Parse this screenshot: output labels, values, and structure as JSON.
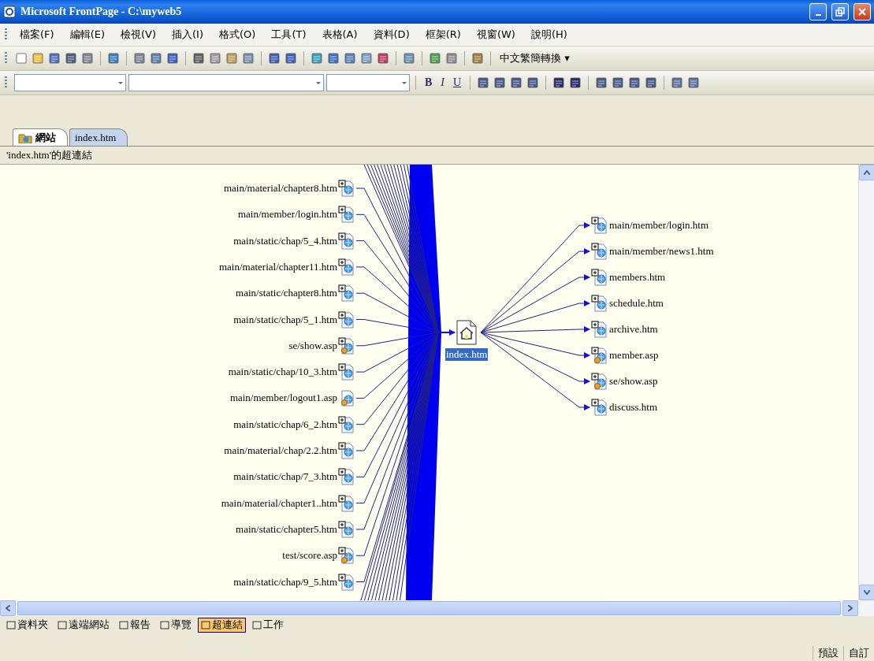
{
  "window": {
    "title": "Microsoft FrontPage - C:\\myweb5"
  },
  "menu": [
    "檔案(F)",
    "編輯(E)",
    "檢視(V)",
    "插入(I)",
    "格式(O)",
    "工具(T)",
    "表格(A)",
    "資料(D)",
    "框架(R)",
    "視窗(W)",
    "說明(H)"
  ],
  "toolbar": {
    "convert_button": "中文繁簡轉換 ▾"
  },
  "format_toolbar": {
    "buttons": [
      {
        "label": "B",
        "kind": "bold"
      },
      {
        "label": "I",
        "kind": "italic"
      },
      {
        "label": "U",
        "kind": "underline"
      }
    ]
  },
  "tabs": [
    {
      "label": "網站",
      "selected": true,
      "kind": "site"
    },
    {
      "label": "index.htm",
      "selected": false,
      "kind": "page"
    }
  ],
  "view_title": "'index.htm'的超連結",
  "hyperlinks": {
    "center": {
      "label": "index.htm",
      "selected": true
    },
    "incoming": [
      {
        "label": "main/material/chapter8.htm",
        "kind": "page",
        "expandable": true
      },
      {
        "label": "main/member/login.htm",
        "kind": "page",
        "expandable": true
      },
      {
        "label": "main/static/chap/5_4.htm",
        "kind": "page",
        "expandable": true
      },
      {
        "label": "main/material/chapter11.htm",
        "kind": "page",
        "expandable": true
      },
      {
        "label": "main/static/chapter8.htm",
        "kind": "page",
        "expandable": true
      },
      {
        "label": "main/static/chap/5_1.htm",
        "kind": "page",
        "expandable": true
      },
      {
        "label": "se/show.asp",
        "kind": "script",
        "expandable": true
      },
      {
        "label": "main/static/chap/10_3.htm",
        "kind": "page",
        "expandable": true
      },
      {
        "label": "main/member/logout1.asp",
        "kind": "script",
        "expandable": false
      },
      {
        "label": "main/static/chap/6_2.htm",
        "kind": "page",
        "expandable": true
      },
      {
        "label": "main/material/chap/2.2.htm",
        "kind": "page",
        "expandable": true
      },
      {
        "label": "main/static/chap/7_3.htm",
        "kind": "page",
        "expandable": true
      },
      {
        "label": "main/material/chapter1..htm",
        "kind": "page",
        "expandable": true
      },
      {
        "label": "main/static/chapter5.htm",
        "kind": "page",
        "expandable": true
      },
      {
        "label": "test/score.asp",
        "kind": "script",
        "expandable": true
      },
      {
        "label": "main/static/chap/9_5.htm",
        "kind": "page",
        "expandable": true
      }
    ],
    "outgoing": [
      {
        "label": "main/member/login.htm",
        "kind": "page",
        "expandable": true
      },
      {
        "label": "main/member/news1.htm",
        "kind": "page",
        "expandable": true
      },
      {
        "label": "members.htm",
        "kind": "page",
        "expandable": true
      },
      {
        "label": "schedule.htm",
        "kind": "page",
        "expandable": true
      },
      {
        "label": "archive.htm",
        "kind": "page",
        "expandable": true
      },
      {
        "label": "member.asp",
        "kind": "script",
        "expandable": true
      },
      {
        "label": "se/show.asp",
        "kind": "script",
        "expandable": true
      },
      {
        "label": "discuss.htm",
        "kind": "page",
        "expandable": true
      }
    ]
  },
  "views": [
    {
      "label": "資料夾",
      "selected": false
    },
    {
      "label": "遠端網站",
      "selected": false
    },
    {
      "label": "報告",
      "selected": false
    },
    {
      "label": "導覽",
      "selected": false
    },
    {
      "label": "超連結",
      "selected": true
    },
    {
      "label": "工作",
      "selected": false
    }
  ],
  "status_bar": [
    "預設",
    "自訂"
  ]
}
